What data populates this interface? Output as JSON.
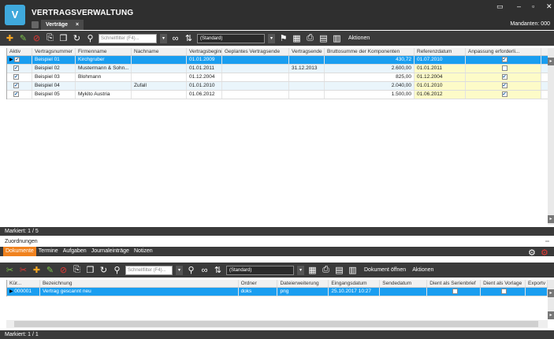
{
  "app": {
    "logo_text": "V",
    "title": "VERTRAGSVERWALTUNG",
    "tab_label": "Verträge",
    "tab_close": "×",
    "mandant": "Mandanten: 000",
    "window_controls": [
      "▭",
      "–",
      "▫",
      "✕"
    ]
  },
  "toolbar_top": {
    "filter_placeholder": "Schnellfilter (F4)...",
    "view_combo": "(Standard)",
    "actions_label": "Aktionen",
    "icons": [
      "add-icon",
      "edit-icon",
      "delete-icon",
      "export-icon",
      "copy-icon",
      "refresh-icon",
      "filter-icon",
      "search-icon",
      "sort-icon",
      "flag-icon",
      "grid-icon",
      "print-icon",
      "document-icon",
      "documents-icon"
    ]
  },
  "main_grid": {
    "columns": [
      "Aktiv",
      "Vertragsnummer",
      "Firmenname",
      "Nachname",
      "Vertragsbeginn",
      "Geplantes Vertragsende",
      "Vertragsende",
      "Bruttosumme der Komponenten",
      "Referenzdatum",
      "Anpassung erforderli..."
    ],
    "rows": [
      {
        "selected": true,
        "aktiv": true,
        "vertragsnummer": "Beispiel 01",
        "firmenname": "Kirchgruber",
        "nachname": "",
        "beginn": "01.01.2009",
        "geplant": "",
        "ende": "",
        "brutto": "430,72",
        "referenz": "01.07.2010",
        "anpassung": true
      },
      {
        "selected": false,
        "aktiv": true,
        "vertragsnummer": "Beispiel 02",
        "firmenname": "Mustermann & Sohn...",
        "nachname": "",
        "beginn": "01.01.2011",
        "geplant": "",
        "ende": "31.12.2013",
        "brutto": "2.600,00",
        "referenz": "01.01.2011",
        "anpassung": false
      },
      {
        "selected": false,
        "aktiv": true,
        "vertragsnummer": "Beispiel 03",
        "firmenname": "Blohmann",
        "nachname": "",
        "beginn": "01.12.2004",
        "geplant": "",
        "ende": "",
        "brutto": "825,00",
        "referenz": "01.12.2004",
        "anpassung": true
      },
      {
        "selected": false,
        "aktiv": true,
        "vertragsnummer": "Beispiel 04",
        "firmenname": "",
        "nachname": "Zufall",
        "beginn": "01.01.2010",
        "geplant": "",
        "ende": "",
        "brutto": "2.040,00",
        "referenz": "01.01.2010",
        "anpassung": true
      },
      {
        "selected": false,
        "aktiv": true,
        "vertragsnummer": "Beispiel 05",
        "firmenname": "Mykito Austria",
        "nachname": "",
        "beginn": "01.06.2012",
        "geplant": "",
        "ende": "",
        "brutto": "1.500,00",
        "referenz": "01.06.2012",
        "anpassung": true
      }
    ]
  },
  "status_main": "Markiert: 1 / 5",
  "assignments_label": "Zuordnungen",
  "subtabs": [
    "Dokumente",
    "Termine",
    "Aufgaben",
    "Journaleinträge",
    "Notizen"
  ],
  "toolbar_bottom": {
    "filter_placeholder": "Schnellfilter (F4)...",
    "view_combo": "(Standard)",
    "open_doc_label": "Dokument öffnen",
    "actions_label": "Aktionen"
  },
  "doc_grid": {
    "columns": [
      "Kür...",
      "Bezeichnung",
      "Ordner",
      "Dateierweiterung",
      "Eingangsdatum",
      "Sendedatum",
      "Dient als Serienbrief",
      "Dient als Vorlage",
      "Exportv"
    ],
    "rows": [
      {
        "kuerzel": "000001",
        "bezeichnung": "Vertrag gescannt neu",
        "ordner": "doks",
        "ext": "png",
        "eingang": "25.10.2017 10:27",
        "sende": "",
        "serienbrief": false,
        "vorlage": false
      }
    ]
  },
  "status_docs": "Markiert: 1 / 1"
}
